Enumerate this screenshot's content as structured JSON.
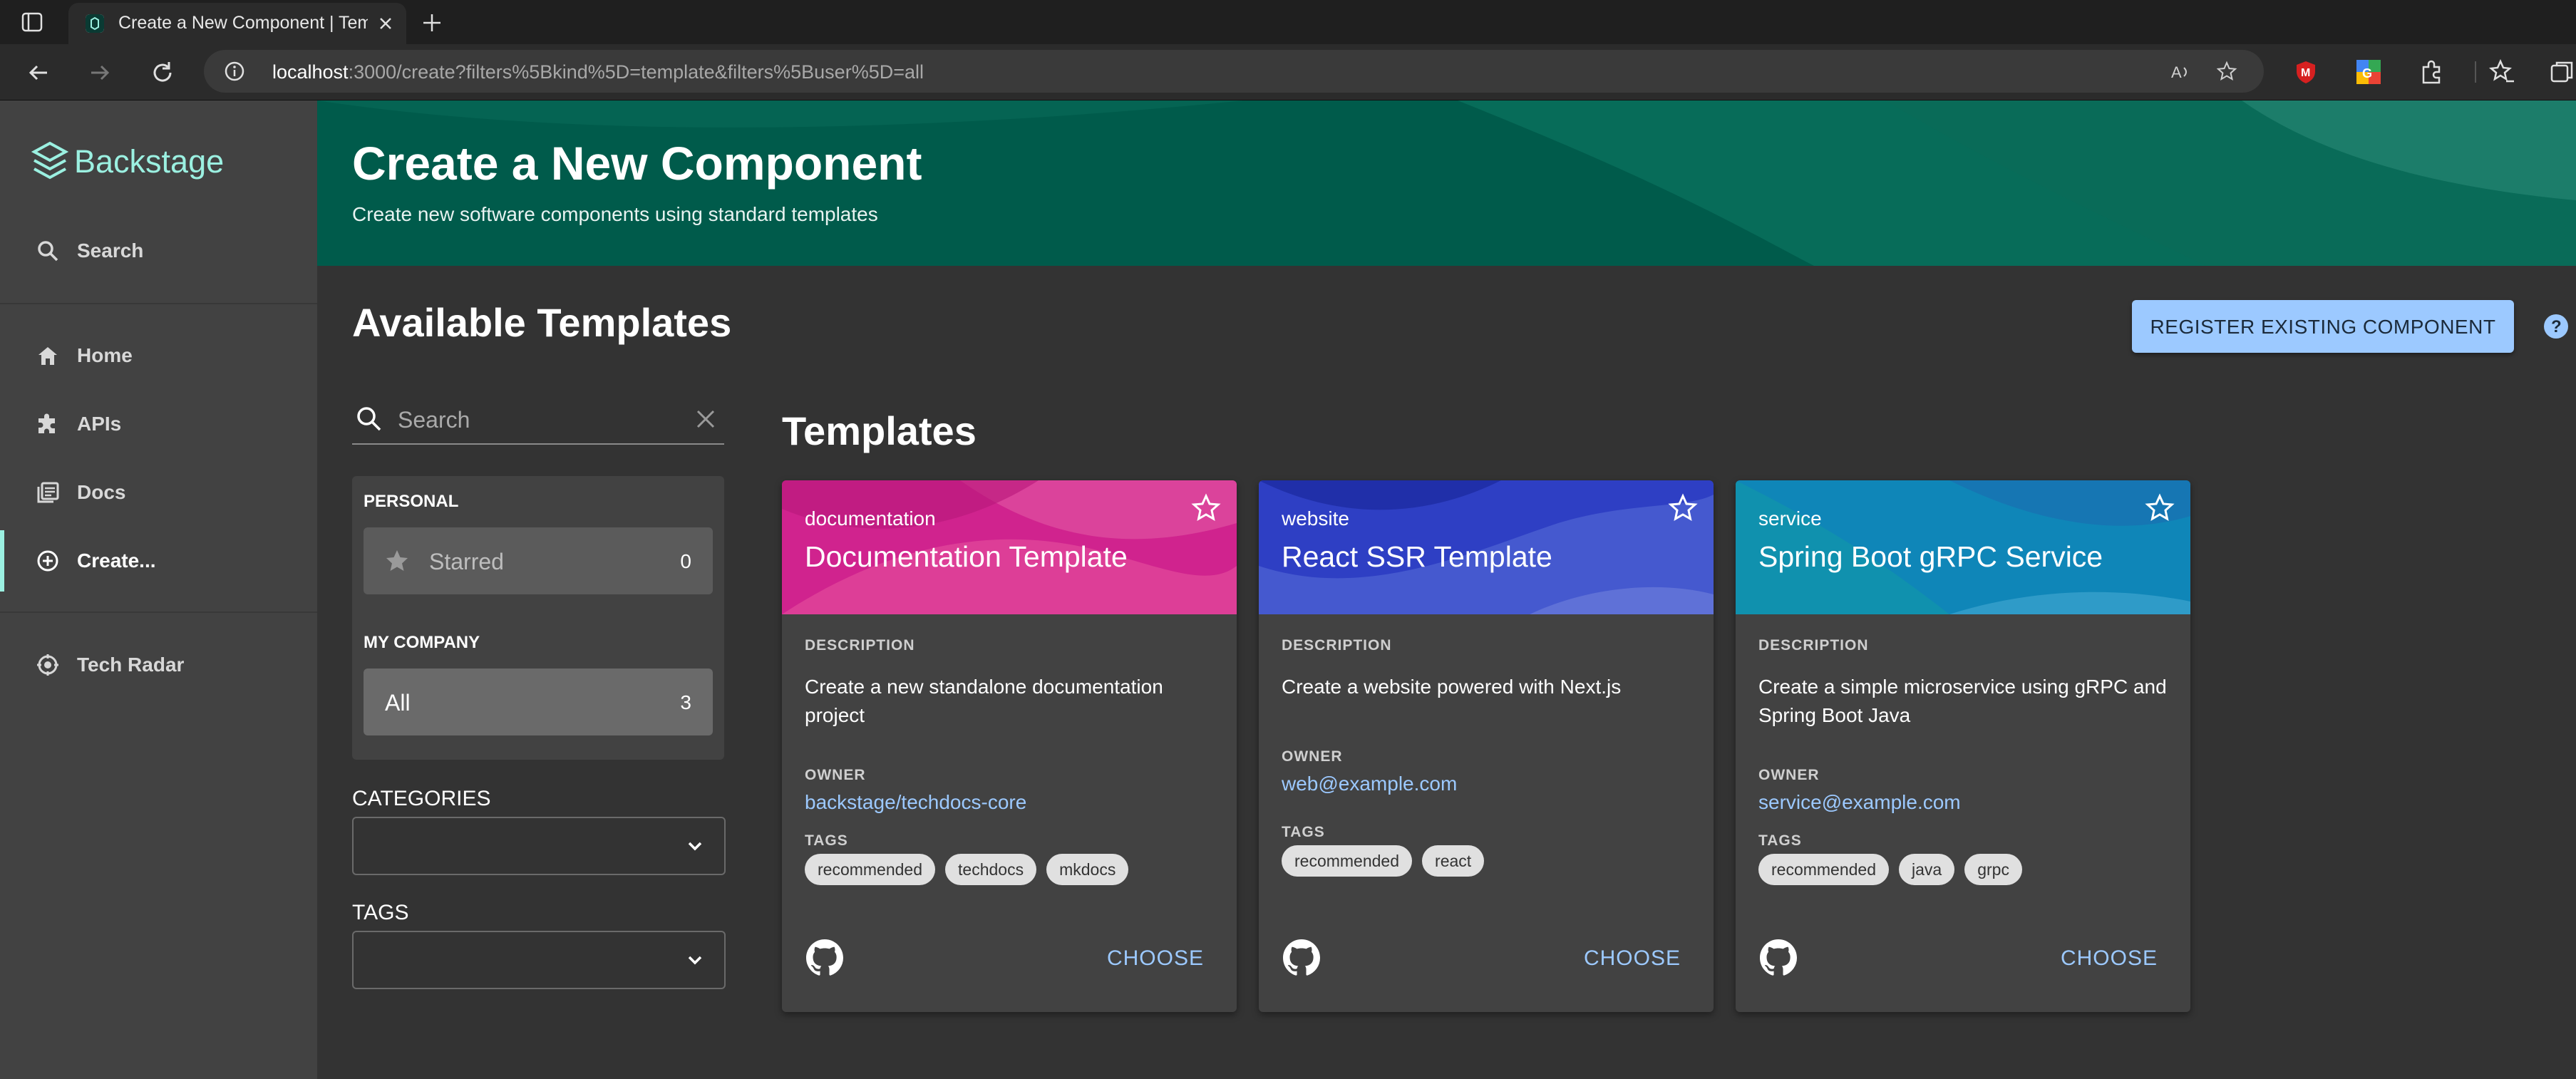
{
  "browser": {
    "tab_title": "Create a New Component | Temp",
    "url_host": "localhost",
    "url_rest": ":3000/create?filters%5Bkind%5D=template&filters%5Buser%5D=all"
  },
  "sidebar": {
    "logo_text": "Backstage",
    "search_label": "Search",
    "items": [
      {
        "label": "Home",
        "icon": "home-icon"
      },
      {
        "label": "APIs",
        "icon": "puzzle-icon"
      },
      {
        "label": "Docs",
        "icon": "docs-icon"
      },
      {
        "label": "Create...",
        "icon": "add-circle-icon"
      },
      {
        "label": "Tech Radar",
        "icon": "radar-icon"
      }
    ]
  },
  "header": {
    "title": "Create a New Component",
    "subtitle": "Create new software components using standard templates"
  },
  "content": {
    "title": "Available Templates",
    "register_button": "REGISTER EXISTING COMPONENT",
    "templates_title": "Templates"
  },
  "filters": {
    "search_placeholder": "Search",
    "personal_heading": "PERSONAL",
    "starred_label": "Starred",
    "starred_count": "0",
    "company_heading": "MY COMPANY",
    "all_label": "All",
    "all_count": "3",
    "categories_label": "CATEGORIES",
    "tags_label": "TAGS"
  },
  "labels": {
    "description": "DESCRIPTION",
    "owner": "OWNER",
    "tags": "TAGS",
    "choose": "CHOOSE"
  },
  "templates": [
    {
      "type": "documentation",
      "title": "Documentation Template",
      "description": "Create a new standalone documentation project",
      "owner": "backstage/techdocs-core",
      "tags": [
        "recommended",
        "techdocs",
        "mkdocs"
      ],
      "color": "#d0238e"
    },
    {
      "type": "website",
      "title": "React SSR Template",
      "description": "Create a website powered with Next.js",
      "owner": "web@example.com",
      "tags": [
        "recommended",
        "react"
      ],
      "color": "#2e3fc4"
    },
    {
      "type": "service",
      "title": "Spring Boot gRPC Service",
      "description": "Create a simple microservice using gRPC and Spring Boot Java",
      "owner": "service@example.com",
      "tags": [
        "recommended",
        "java",
        "grpc"
      ],
      "color": "#0f86b8"
    }
  ]
}
